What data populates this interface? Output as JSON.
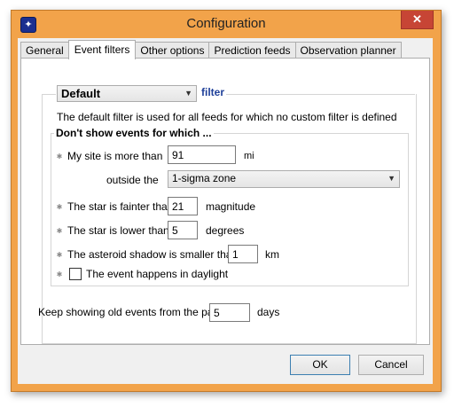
{
  "window": {
    "title": "Configuration",
    "close_symbol": "✕"
  },
  "tabs": [
    {
      "label": "General"
    },
    {
      "label": "Event filters"
    },
    {
      "label": "Other options"
    },
    {
      "label": "Prediction feeds"
    },
    {
      "label": "Observation planner"
    }
  ],
  "active_tab": "Event filters",
  "filter": {
    "selected": "Default",
    "suffix": "filter",
    "description": "The default filter is used for all feeds for which no custom filter is defined"
  },
  "group": {
    "title": "Don't show events for which ...",
    "site": {
      "label": "My site is more than",
      "value": "91",
      "unit": "mi"
    },
    "outside": {
      "label": "outside the",
      "selected": "1-sigma zone"
    },
    "fainter": {
      "label": "The star is fainter than",
      "value": "21",
      "unit": "magnitude"
    },
    "lower": {
      "label": "The star is lower than",
      "value": "5",
      "unit": "degrees"
    },
    "shadow": {
      "label": "The asteroid shadow is smaller than",
      "value": "1",
      "unit": "km"
    },
    "daylight": {
      "label": "The event happens in daylight",
      "checked": false
    }
  },
  "keep": {
    "label": "Keep showing old events from the past",
    "value": "5",
    "unit": "days"
  },
  "buttons": {
    "ok": "OK",
    "cancel": "Cancel"
  },
  "colors": {
    "frame": "#f2a34a",
    "close": "#c74535",
    "accent": "#1e3f99"
  }
}
